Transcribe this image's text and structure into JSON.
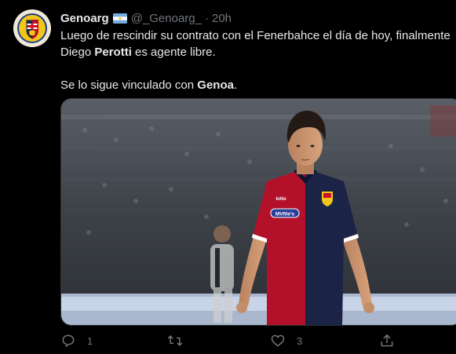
{
  "tweet": {
    "display_name": "Genoarg",
    "handle": "@_Genoarg_",
    "separator": "·",
    "time": "20h",
    "text": {
      "line1": "Luego de rescindir su contrato con el Fenerbahce el día de hoy, finalmente",
      "line2_prefix": "Diego ",
      "line2_bold": "Perotti",
      "line2_suffix": " es agente libre.",
      "line3_prefix": "Se lo sigue vinculado con ",
      "line3_bold": "Genoa",
      "line3_suffix": "."
    },
    "photo": {
      "jersey_sponsor": "MVfile's",
      "jersey_brand": "lotto"
    },
    "actions": {
      "reply_count": "1",
      "retweet_count": "",
      "like_count": "3"
    }
  },
  "colors": {
    "background": "#000000",
    "text": "#e7e9ea",
    "muted": "#71767b",
    "genoa_red": "#b3112a",
    "genoa_blue": "#1b2447"
  }
}
